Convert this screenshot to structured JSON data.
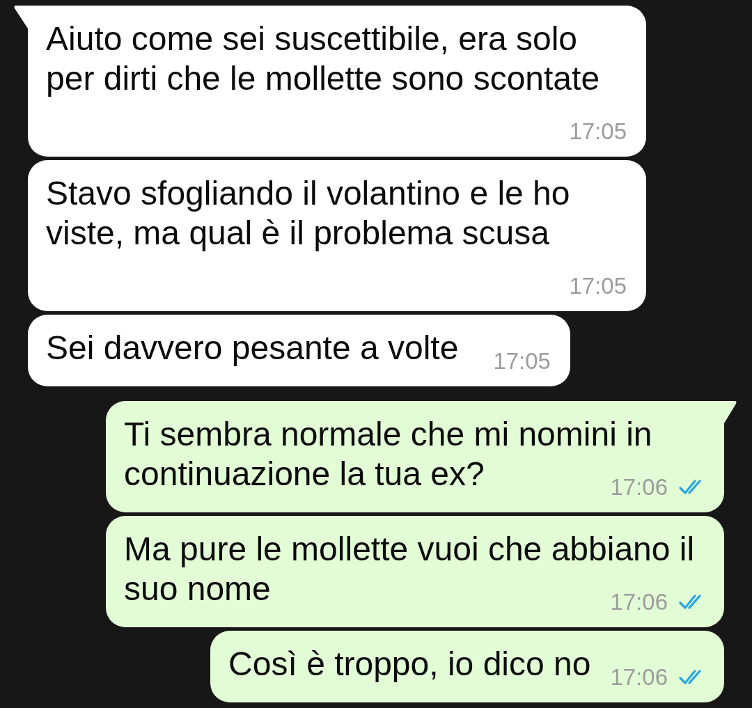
{
  "messages": [
    {
      "kind": "incoming",
      "tail": true,
      "text": "Aiuto come sei suscettibile, era solo\nper dirti che le mollette sono scontate",
      "time": "17:05"
    },
    {
      "kind": "incoming",
      "tail": false,
      "text": "Stavo sfogliando il volantino e le ho\nviste, ma qual è il problema scusa",
      "time": "17:05"
    },
    {
      "kind": "incoming",
      "tail": false,
      "text": "Sei davvero pesante a volte",
      "time": "17:05"
    },
    {
      "kind": "outgoing",
      "tail": true,
      "text": "Ti sembra normale che mi nomini in\ncontinuazione la tua ex?",
      "time": "17:06",
      "read": true
    },
    {
      "kind": "outgoing",
      "tail": false,
      "text": "Ma pure le mollette vuoi che abbiano il\nsuo nome",
      "time": "17:06",
      "read": true
    },
    {
      "kind": "outgoing",
      "tail": false,
      "text": "Così è troppo, io dico no",
      "time": "17:06",
      "read": true
    }
  ]
}
